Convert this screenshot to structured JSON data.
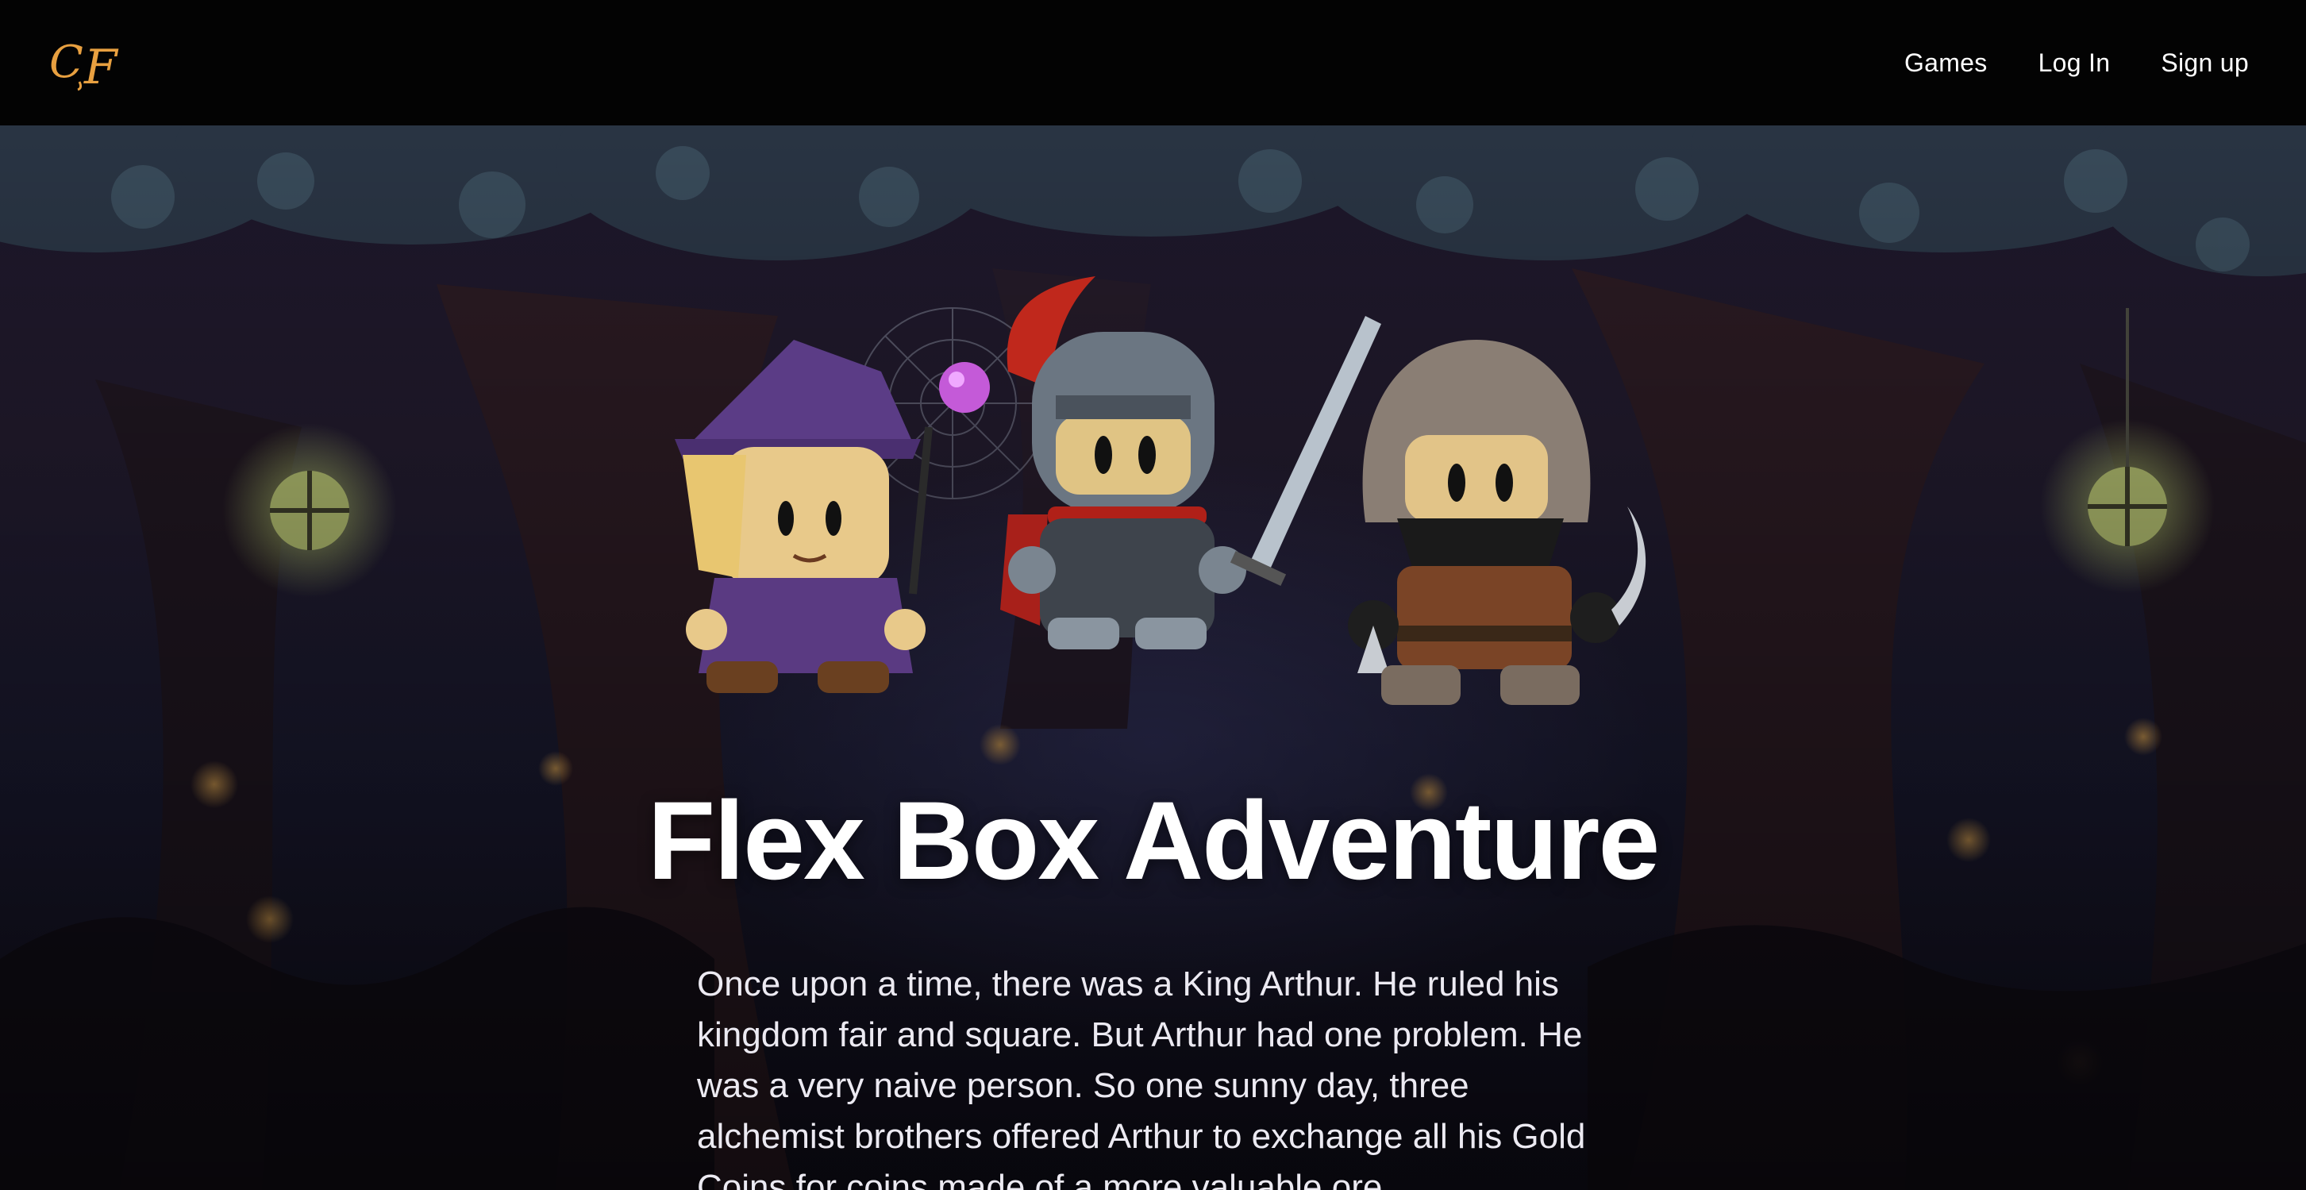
{
  "header": {
    "logo_text": "CF",
    "nav": [
      {
        "label": "Games"
      },
      {
        "label": "Log In"
      },
      {
        "label": "Sign up"
      }
    ]
  },
  "hero": {
    "title": "Flex Box Adventure",
    "story": "Once upon a time, there was a King Arthur. He ruled his kingdom fair and square. But Arthur had one problem. He was a very naive person. So one sunny day, three alchemist brothers offered Arthur to exchange all his Gold Coins for coins made of a more valuable ore",
    "characters": [
      "wizard",
      "knight",
      "rogue"
    ]
  },
  "colors": {
    "logo": "#e8a040",
    "header_bg": "#030303",
    "hero_bg": "#1b1629"
  }
}
